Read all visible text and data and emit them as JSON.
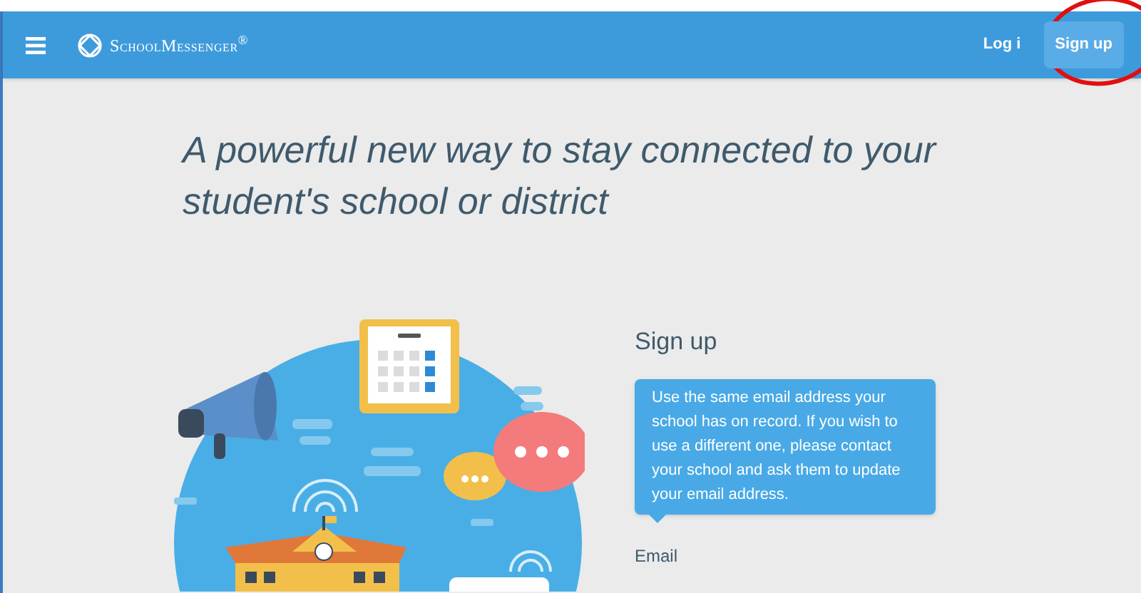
{
  "navbar": {
    "brand": "SchoolMessenger",
    "brand_mark": "®",
    "login_link": "Log i",
    "signup_button": "Sign up",
    "signup_circled": true
  },
  "headline": "A powerful new way to stay connected to your student's school or district",
  "form": {
    "title": "Sign up",
    "tooltip": "Use the same email address your school has on record. If you wish to use a different one, please contact your school and ask them to update your email address.",
    "email_label": "Email"
  }
}
